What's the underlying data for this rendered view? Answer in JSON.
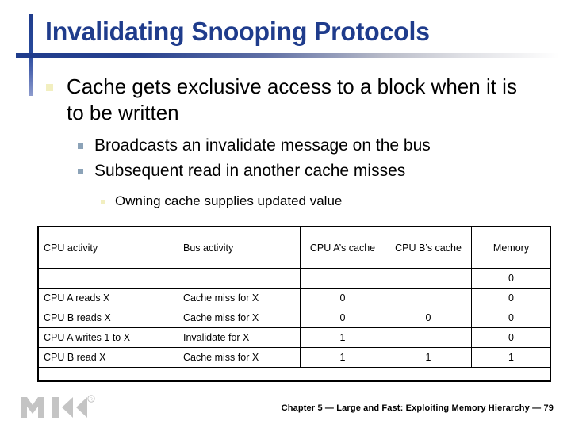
{
  "slide": {
    "title": "Invalidating Snooping Protocols",
    "title_color": "#1F3C8C",
    "accent_color": "#1F3C8C"
  },
  "bullets": {
    "level1": {
      "text": "Cache gets exclusive access to a block when it is to be written",
      "marker_color": "#F2EFC0"
    },
    "level2": [
      {
        "text": "Broadcasts an invalidate message on the bus",
        "marker_color": "#8CA3B8"
      },
      {
        "text": "Subsequent read in another cache misses",
        "marker_color": "#8CA3B8"
      }
    ],
    "level3": [
      {
        "text": "Owning cache supplies updated value",
        "marker_color": "#F2EFC0"
      }
    ]
  },
  "table": {
    "headers": [
      "CPU activity",
      "Bus activity",
      "CPU A’s cache",
      "CPU B’s cache",
      "Memory"
    ],
    "rows": [
      {
        "cpu_activity": "",
        "bus_activity": "",
        "cpu_a_cache": "",
        "cpu_b_cache": "",
        "memory": "0"
      },
      {
        "cpu_activity": "CPU A reads X",
        "bus_activity": "Cache miss for X",
        "cpu_a_cache": "0",
        "cpu_b_cache": "",
        "memory": "0"
      },
      {
        "cpu_activity": "CPU B reads X",
        "bus_activity": "Cache miss for X",
        "cpu_a_cache": "0",
        "cpu_b_cache": "0",
        "memory": "0"
      },
      {
        "cpu_activity": "CPU A writes 1 to X",
        "bus_activity": "Invalidate for X",
        "cpu_a_cache": "1",
        "cpu_b_cache": "",
        "memory": "0"
      },
      {
        "cpu_activity": "CPU B read X",
        "bus_activity": "Cache miss for X",
        "cpu_a_cache": "1",
        "cpu_b_cache": "1",
        "memory": "1"
      }
    ]
  },
  "footer": {
    "text": "Chapter 5 — Large and Fast: Exploiting Memory Hierarchy — 79",
    "logo_label": "MK",
    "logo_trademark": "®",
    "logo_color": "#C4C4C4"
  }
}
